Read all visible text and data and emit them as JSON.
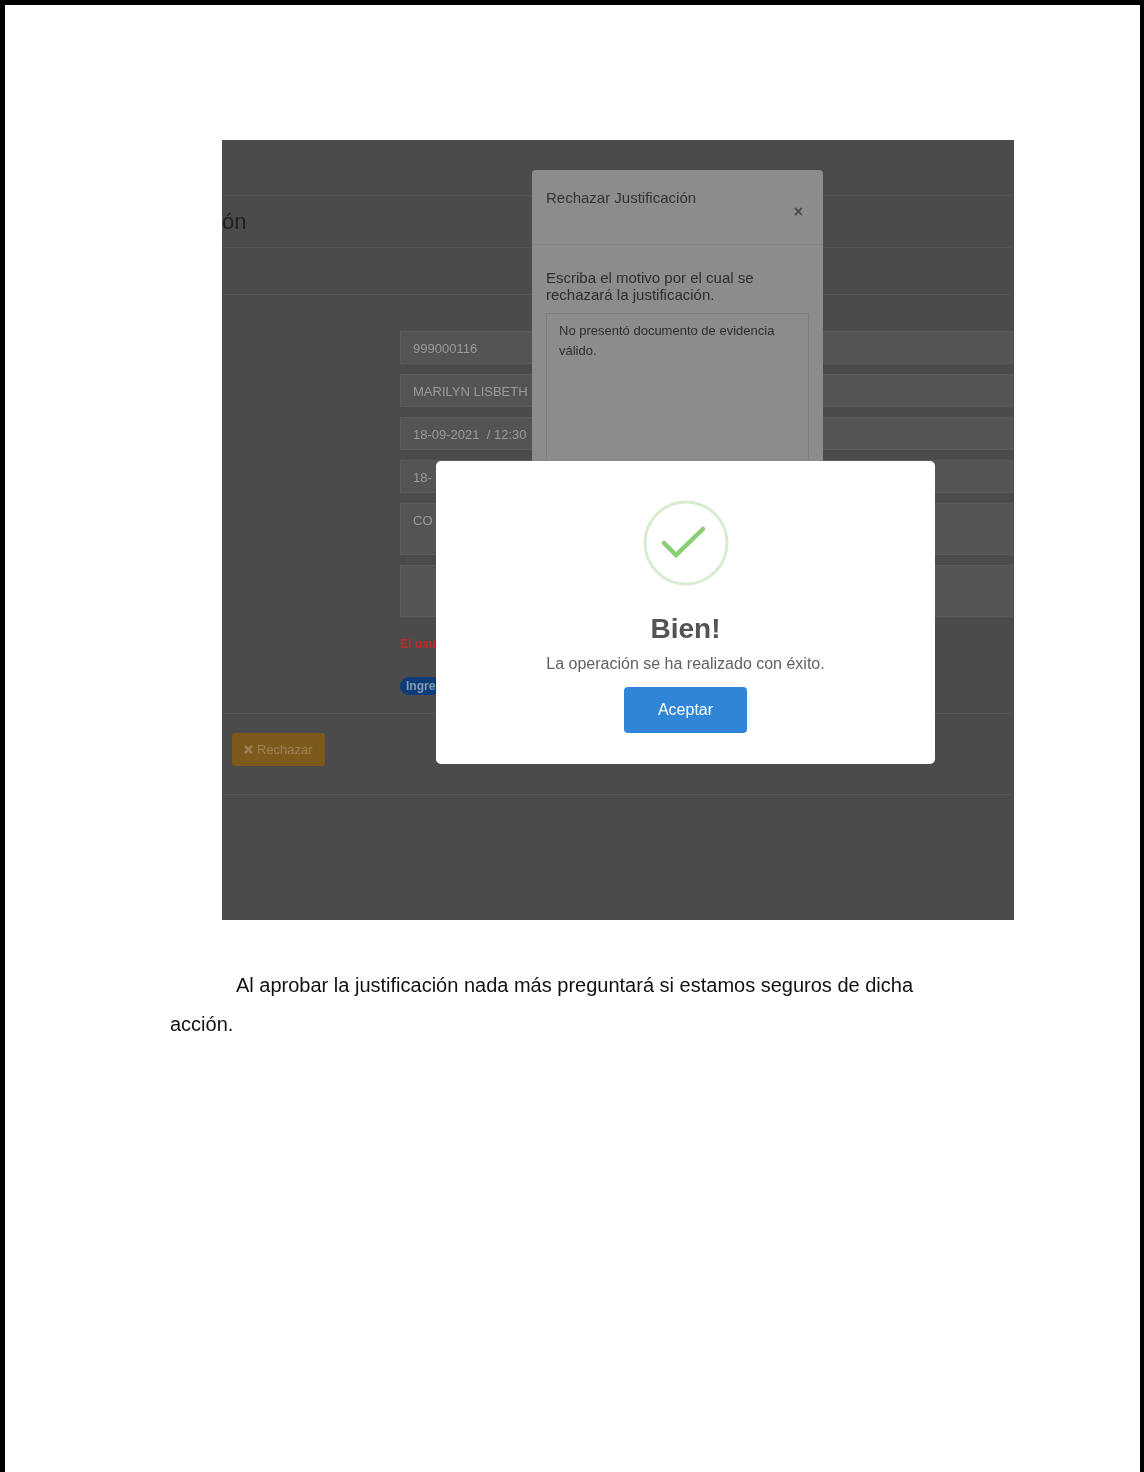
{
  "screenshot": {
    "page_heading": "ón",
    "fields": [
      {
        "kind": "input",
        "value": "999000116"
      },
      {
        "kind": "input",
        "value": "MARILYN LISBETH"
      },
      {
        "kind": "input",
        "value": "18-09-2021  / 12:30"
      },
      {
        "kind": "input",
        "value": "18-"
      },
      {
        "kind": "area",
        "value": "CO"
      },
      {
        "kind": "area"
      }
    ],
    "warning": "El usu",
    "badge": "Ingre",
    "reject_button": "Rechazar",
    "reject_dialog": {
      "title": "Rechazar Justificación",
      "close": "×",
      "prompt": "Escriba el motivo por el cual se rechazará la justificación.",
      "reason": "No presentó documento de evidencia válido."
    },
    "success_dialog": {
      "title": "Bien!",
      "message": "La operación se ha realizado con éxito.",
      "button": "Aceptar"
    }
  },
  "document": {
    "paragraph": "Al aprobar la justificación nada más preguntará si estamos seguros de dicha acción."
  }
}
